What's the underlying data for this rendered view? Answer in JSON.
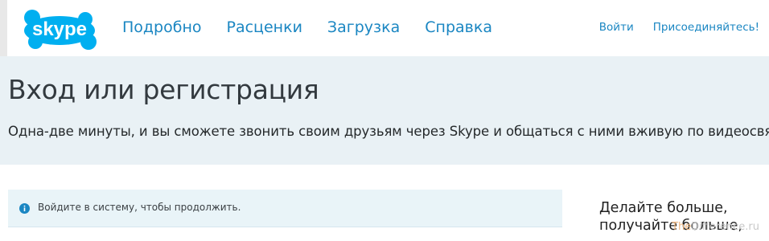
{
  "brand": {
    "logo_text": "skype"
  },
  "nav": {
    "items": [
      {
        "label": "Подробно"
      },
      {
        "label": "Расценки"
      },
      {
        "label": "Загрузка"
      },
      {
        "label": "Справка"
      }
    ]
  },
  "auth": {
    "login_label": "Войти",
    "join_label": "Присоединяйтесь!"
  },
  "hero": {
    "title": "Вход или регистрация",
    "subtitle": "Одна-две минуты, и вы сможете звонить своим друзьям через Skype и общаться с ними вживую по видеосвязи."
  },
  "notice": {
    "icon": "info-icon",
    "message": "Войдите в систему, чтобы продолжить."
  },
  "side": {
    "line1": "Делайте больше,",
    "line2": "получайте больше,"
  },
  "watermark": {
    "prefix": "The",
    "suffix": "Difference.ru"
  },
  "colors": {
    "link": "#1a86c2",
    "hero_bg": "#e9f1f5",
    "notice_bg": "#e9f4f8",
    "logo": "#00aff0"
  }
}
